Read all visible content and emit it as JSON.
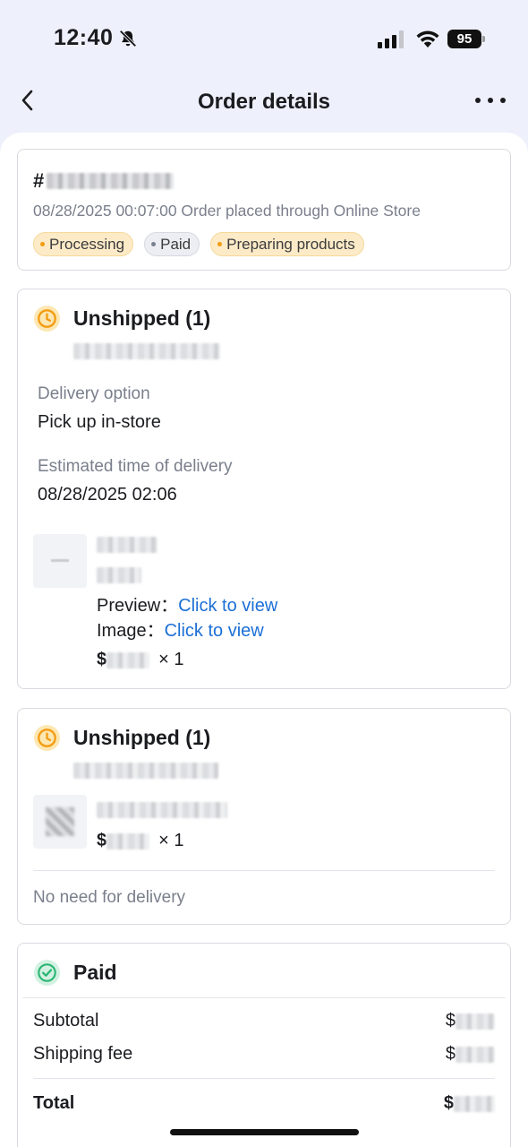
{
  "status_bar": {
    "time": "12:40",
    "battery": "95",
    "icons": [
      "bell-off-icon",
      "signal-icon",
      "wifi-icon",
      "battery-icon"
    ]
  },
  "nav": {
    "title": "Order details",
    "back_icon": "chevron-left-icon",
    "more_icon": "more-horizontal-icon"
  },
  "order_summary": {
    "id_prefix": "#",
    "placed_text": "08/28/2025 00:07:00 Order placed through Online Store",
    "tags": [
      {
        "label": "Processing",
        "style": "orange"
      },
      {
        "label": "Paid",
        "style": "gray"
      },
      {
        "label": "Preparing products",
        "style": "orange"
      }
    ]
  },
  "shipment_1": {
    "title": "Unshipped (1)",
    "delivery_option_label": "Delivery option",
    "delivery_option_value": "Pick up in-store",
    "eta_label": "Estimated time of delivery",
    "eta_value": "08/28/2025 02:06",
    "item": {
      "preview_label": "Preview：",
      "preview_link": "Click to view",
      "image_label": "Image：",
      "image_link": "Click to view",
      "price_prefix": "$",
      "quantity": "× 1"
    }
  },
  "shipment_2": {
    "title": "Unshipped (1)",
    "item": {
      "price_prefix": "$",
      "quantity": "× 1"
    },
    "footer_note": "No need for delivery"
  },
  "payment": {
    "title": "Paid",
    "rows": [
      {
        "label": "Subtotal",
        "currency": "$"
      },
      {
        "label": "Shipping fee",
        "currency": "$"
      },
      {
        "label": "Total",
        "currency": "$"
      }
    ]
  },
  "colors": {
    "accent_link": "#1c6fd6",
    "status_orange": "#f39c12",
    "paid_green": "#2bb673",
    "background": "#eef1fb"
  }
}
